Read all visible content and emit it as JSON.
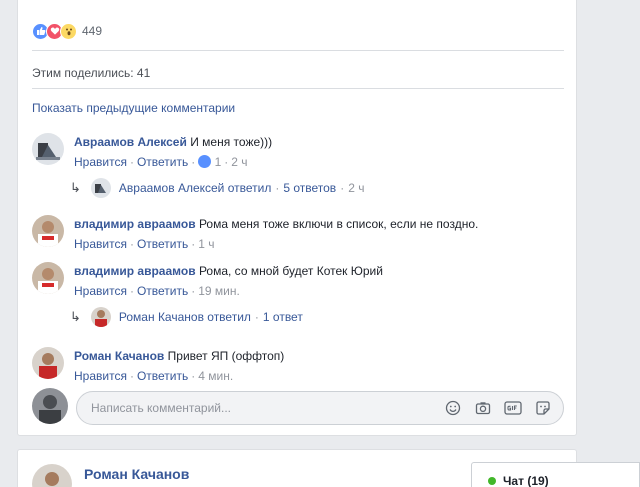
{
  "reactions": {
    "count": "449",
    "types": [
      "like-icon",
      "love-icon",
      "wow-icon"
    ]
  },
  "shared_text": "Этим поделились: 41",
  "show_previous": "Показать предыдущие комментарии",
  "comments": [
    {
      "author": "Авраамов Алексей",
      "text": "И меня тоже)))",
      "like": "Нравится",
      "reply": "Ответить",
      "like_count": "1",
      "time": "2 ч",
      "reply_summary": {
        "author_action": "Авраамов Алексей ответил",
        "count": "5 ответов",
        "time": "2 ч"
      }
    },
    {
      "author": "владимир авраамов",
      "text": "Рома меня тоже включи в список, если не поздно.",
      "like": "Нравится",
      "reply": "Ответить",
      "time": "1 ч"
    },
    {
      "author": "владимир авраамов",
      "text": "Рома, со мной будет Котек Юрий",
      "like": "Нравится",
      "reply": "Ответить",
      "time": "19 мин.",
      "reply_summary": {
        "author_action": "Роман Качанов ответил",
        "count": "1 ответ"
      }
    },
    {
      "author": "Роман Качанов",
      "text": "Привет ЯП (оффтоп)",
      "like": "Нравится",
      "reply": "Ответить",
      "time": "4 мин."
    }
  ],
  "composer": {
    "placeholder": "Написать комментарий..."
  },
  "next_post": {
    "author": "Роман Качанов"
  },
  "chat": {
    "label": "Чат (19)",
    "status_color": "#42b72a"
  },
  "colors": {
    "link": "#385898",
    "meta": "#90949c",
    "like_blue": "#5890ff"
  }
}
